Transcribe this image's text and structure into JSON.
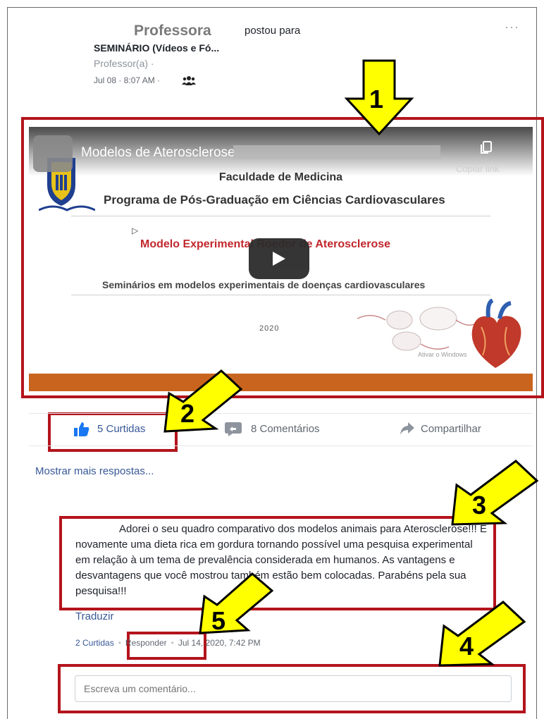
{
  "post": {
    "author": "Professora",
    "posted_to": "postou para",
    "group": "SEMINÁRIO (Vídeos e Fó...",
    "role": "Professor(a) ·",
    "time": "Jul 08 · 8:07 AM ·",
    "more": "···"
  },
  "video": {
    "title": "Modelos de Aterosclerose",
    "copy_link": "Copiar link",
    "faculty": "Faculdade de Medicina",
    "program": "Programa de Pós-Graduação em Ciências Cardiovasculares",
    "cursor": "▷",
    "slide_title": "Modelo Experimental Roedor de Aterosclerose",
    "seminars": "Seminários em modelos experimentais de doenças cardiovasculares",
    "year": "2020",
    "watermark": "Ativar o Windows"
  },
  "actions": {
    "likes": "5 Curtidas",
    "comments": "8 Comentários",
    "share": "Compartilhar"
  },
  "show_more": "Mostrar mais respostas...",
  "comment": {
    "text_line1": "Adorei o seu quadro comparativo dos modelos animais para",
    "text_rest": "Aterosclerose!!! E novamente uma dieta rica em gordura tornando possível uma pesquisa experimental em relação à um tema de prevalência considerada em humanos. As vantagens e desvantagens que você mostrou também estão bem colocadas. Parabéns pela sua pesquisa!!!",
    "translate": "Traduzir",
    "likes": "2 Curtidas",
    "reply": "Responder",
    "date": "Jul 14, 2020, 7:42 PM"
  },
  "comment_input": {
    "placeholder": "Escreva um comentário..."
  },
  "annotations": [
    "1",
    "2",
    "3",
    "4",
    "5"
  ],
  "colors": {
    "highlight": "#b3141c",
    "arrow": "#ffff00",
    "link": "#385898",
    "video_bar": "#c8641e"
  }
}
